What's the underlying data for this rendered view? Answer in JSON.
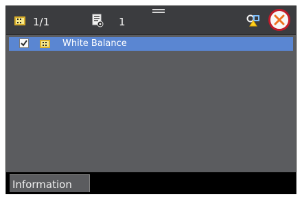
{
  "header": {
    "clip_counter": "1/1",
    "doc_counter": "1",
    "close_label": "Close"
  },
  "list": {
    "items": [
      {
        "label": "White Balance",
        "checked": true,
        "selected": true
      }
    ]
  },
  "tabs": [
    {
      "label": "Information",
      "active": true
    }
  ],
  "icons": {
    "clip": "film-clip-icon",
    "document": "document-eye-icon",
    "shapes": "shapes-icon",
    "close": "close-icon",
    "check": "check-icon"
  },
  "colors": {
    "selection": "#5a86d2",
    "close_ring": "#c21b2a",
    "close_x": "#ee6f1f"
  }
}
